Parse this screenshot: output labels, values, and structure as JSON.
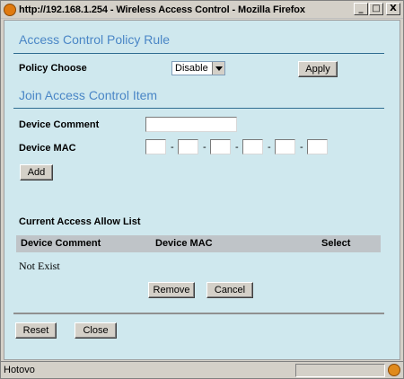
{
  "window": {
    "title": "http://192.168.1.254 - Wireless Access Control - Mozilla Firefox",
    "minimize": "_",
    "maximize": "□",
    "close": "X"
  },
  "policy": {
    "section_title": "Access Control Policy Rule",
    "label": "Policy Choose",
    "selected": "Disable",
    "apply_label": "Apply"
  },
  "join": {
    "section_title": "Join Access Control Item",
    "comment_label": "Device Comment",
    "comment_value": "",
    "mac_label": "Device MAC",
    "mac_separator": "-",
    "mac_octets": [
      "",
      "",
      "",
      "",
      "",
      ""
    ],
    "add_label": "Add"
  },
  "allow_list": {
    "title": "Current Access Allow List",
    "columns": [
      "Device Comment",
      "Device MAC",
      "Select"
    ],
    "empty_text": "Not Exist",
    "remove_label": "Remove",
    "cancel_label": "Cancel"
  },
  "footer": {
    "reset_label": "Reset",
    "close_label": "Close"
  },
  "statusbar": {
    "text": "Hotovo"
  },
  "colors": {
    "content_bg": "#cfe8ee",
    "section_title": "#4a86c6",
    "table_header": "#bfc4c8"
  }
}
